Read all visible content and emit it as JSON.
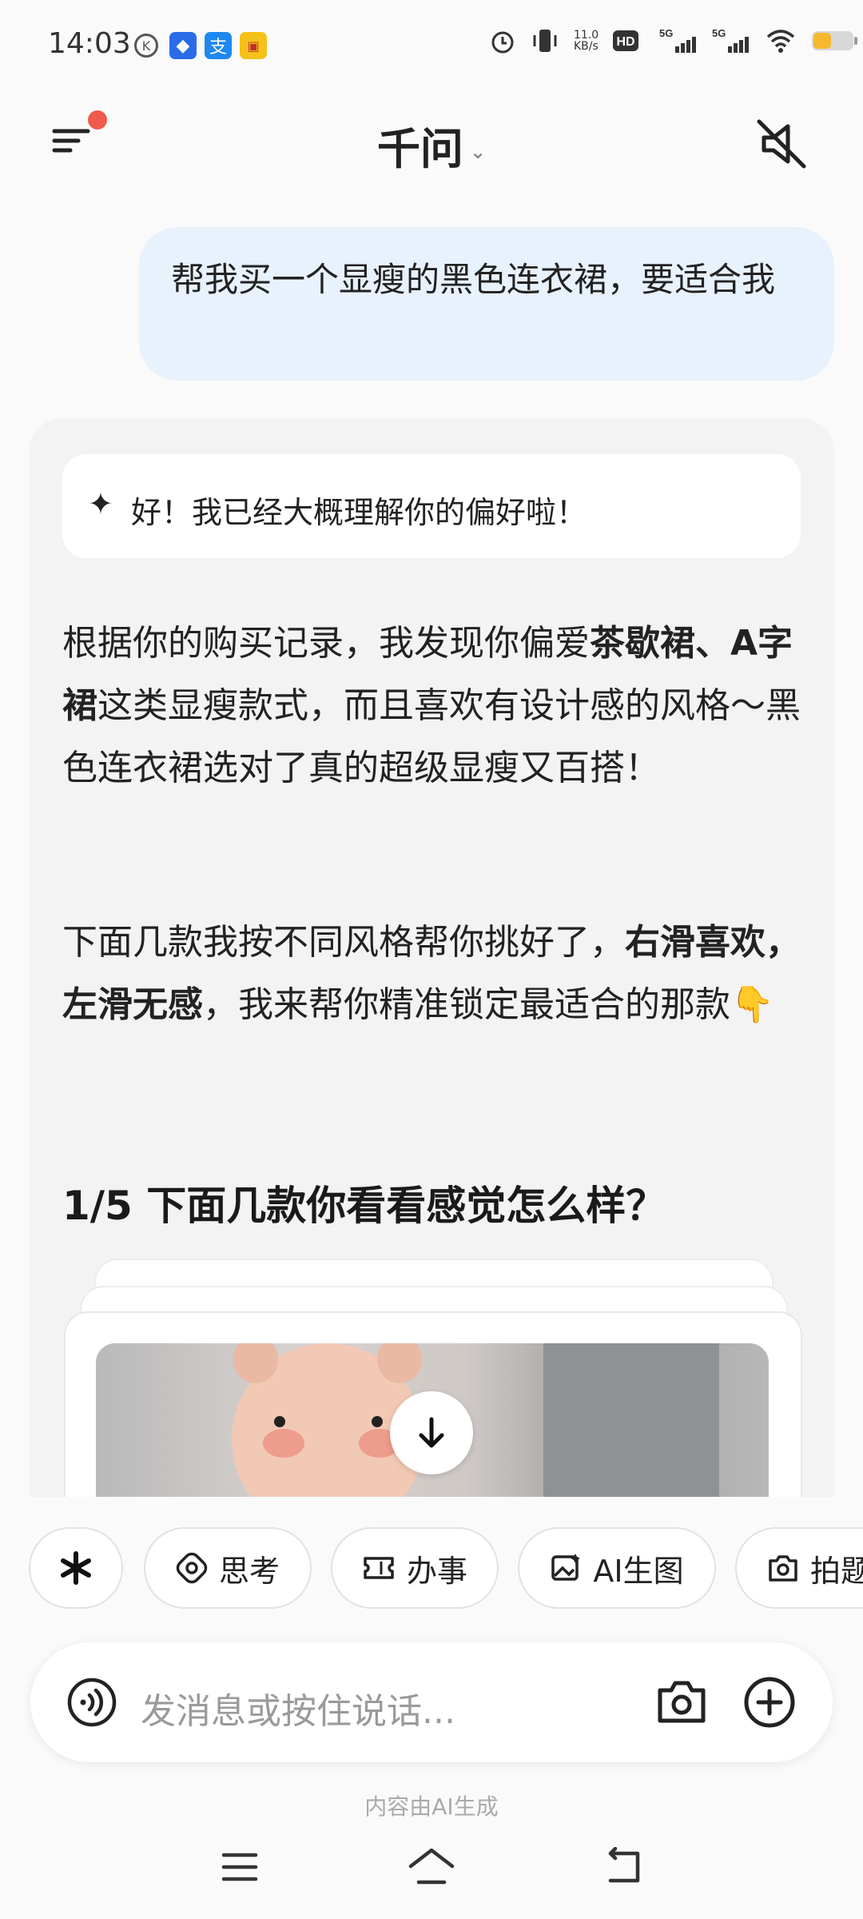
{
  "status_bar": {
    "time": "14:03",
    "net_speed": "11.0\nKB/s",
    "left_icons": [
      "k-circle-icon",
      "app-blue-icon",
      "alipay-icon",
      "app-yellow-icon"
    ],
    "right_icons": [
      "alarm-icon",
      "vibrate-icon",
      "hd-icon",
      "signal-5g-icon",
      "signal-5g-icon",
      "wifi-icon",
      "battery-icon"
    ]
  },
  "header": {
    "title": "千问",
    "chevron": "⌄"
  },
  "user_message": "帮我买一个显瘦的黑色连衣裙，要适合我",
  "assistant": {
    "thought_star": "✦",
    "thought_text": "好！我已经大概理解你的偏好啦！",
    "p1_before": "根据你的购买记录，我发现你偏爱",
    "p1_bold1": "茶歇裙",
    "p1_sep": "、",
    "p1_bold2": "A字裙",
    "p1_after": "这类显瘦款式，而且喜欢有设计感的风格～黑色连衣裙选对了真的超级显瘦又百搭！",
    "p2_before": "下面几款我按不同风格帮你挑好了，",
    "p2_bold": "右滑喜欢，左滑无感",
    "p2_after": "，我来帮你精准锁定最适合的那款👇",
    "section_title": "1/5 下面几款你看看感觉怎么样？"
  },
  "chips": [
    {
      "label": ""
    },
    {
      "label": "思考"
    },
    {
      "label": "办事"
    },
    {
      "label": "AI生图"
    },
    {
      "label": "拍题"
    }
  ],
  "input": {
    "placeholder": "发消息或按住说话..."
  },
  "ai_note": "内容由AI生成"
}
